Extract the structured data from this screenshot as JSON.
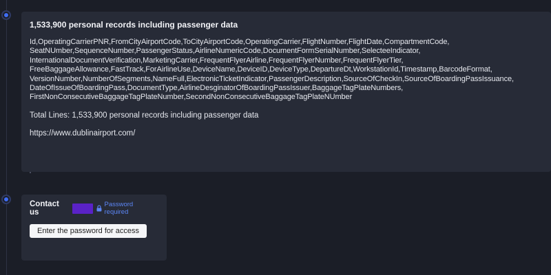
{
  "records_post": {
    "title": "1,533,900 personal records including passenger data",
    "fields_text": "Id,OperatingCarrierPNR,FromCityAirportCode,ToCityAirportCode,OperatingCarrier,FlightNumber,FlightDate,CompartmentCode, SeatNUmber,SequenceNumber,PassengerStatus,AirlineNumericCode,DocumentFormSerialNumber,SelecteeIndicator, InternationalDocumentVerification,MarketingCarrier,FrequentFlyerAirline,FrequentFlyerNumber,FrequentFlyerTier, FreeBaggageAllowance,FastTrack,ForAirlineUse,DeviceName,DeviceID,DeviceType,DepartureDt,WorkstationId,Timestamp,BarcodeFormat, VersionNumber,NumberOfSegments,NameFull,ElectronicTicketIndicator,PassengerDescription,SourceOfCheckIn,SourceOfBoardingPassIssuance, DateOfIssueOfBoardingPass,DocumentType,AirlineDesginatorOfBoardingPassIssuer,BaggageTagPlateNumbers, FirstNonConsecutiveBaggageTagPlateNumber,SecondNonConsecutiveBaggageTagPlateNUmber",
    "total_lines": "Total Lines: 1,533,900 personal records including passenger data",
    "website": "https://www.dublinairport.com/"
  },
  "contact": {
    "title": "Contact us",
    "password_label": "Password required",
    "button_label": "Enter the password for access",
    "icon": "lock-icon"
  },
  "colors": {
    "background": "#1b1e27",
    "card": "#272b37",
    "accent": "#3f6df5",
    "redaction": "#5a22c7",
    "link": "#5c86f5"
  }
}
